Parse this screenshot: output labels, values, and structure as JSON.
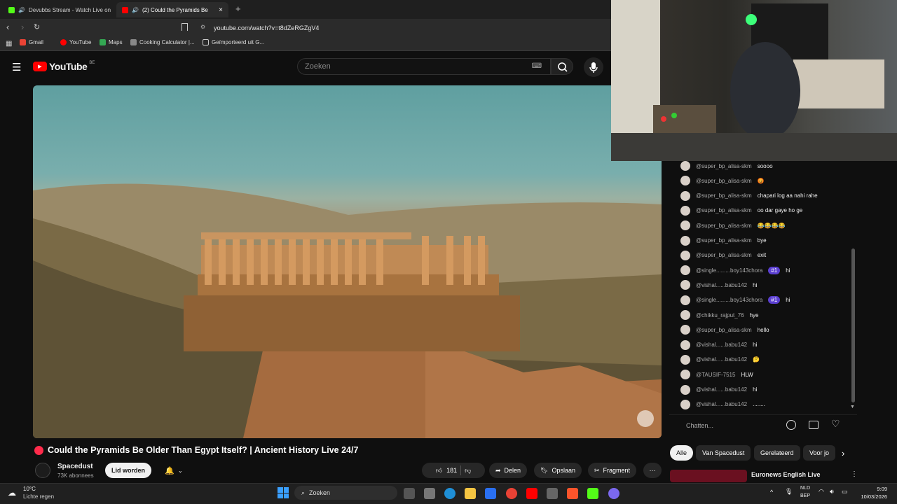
{
  "browser": {
    "tabs": [
      {
        "label": "Devubbs Stream - Watch Live on",
        "active": false
      },
      {
        "label": "(2)  Could the Pyramids Be",
        "active": true
      }
    ],
    "new_tab": "+",
    "url": "youtube.com/watch?v=t8dZeRGZgV4",
    "bookmarks": [
      "Gmail",
      "YouTube",
      "Maps",
      "Cooking Calculator |...",
      "Geïmporteerd uit G..."
    ]
  },
  "youtube": {
    "logo_text": "YouTube",
    "region": "BE",
    "search_placeholder": "Zoeken"
  },
  "video": {
    "title": "Could the Pyramids Be Older Than Egypt Itself? | Ancient History Live 24/7",
    "channel": "Spacedust",
    "subscribers": "73K abonnees",
    "join_label": "Lid worden",
    "likes": "181",
    "share_label": "Delen",
    "save_label": "Opslaan",
    "clip_label": "Fragment"
  },
  "chat": {
    "messages": [
      {
        "author": "@super_bp_alisa-skm",
        "text": "soooo",
        "badge": ""
      },
      {
        "author": "@super_bp_alisa-skm",
        "text": "😡",
        "badge": ""
      },
      {
        "author": "@super_bp_alisa-skm",
        "text": "chapari log aa nahi rahe",
        "badge": ""
      },
      {
        "author": "@super_bp_alisa-skm",
        "text": "oo dar gaye ho ge",
        "badge": ""
      },
      {
        "author": "@super_bp_alisa-skm",
        "text": "😂😂😂😂",
        "badge": ""
      },
      {
        "author": "@super_bp_alisa-skm",
        "text": "bye",
        "badge": ""
      },
      {
        "author": "@super_bp_alisa-skm",
        "text": "exit",
        "badge": ""
      },
      {
        "author": "@single.........boy143chora",
        "text": "hi",
        "badge": "#1"
      },
      {
        "author": "@vishal......babu142",
        "text": "hi",
        "badge": ""
      },
      {
        "author": "@single.........boy143chora",
        "text": "hi",
        "badge": "#1"
      },
      {
        "author": "@chikku_rajput_76",
        "text": "hye",
        "badge": ""
      },
      {
        "author": "@super_bp_alisa-skm",
        "text": "hello",
        "badge": ""
      },
      {
        "author": "@vishal......babu142",
        "text": "hi",
        "badge": ""
      },
      {
        "author": "@vishal......babu142",
        "text": "🤔",
        "badge": ""
      },
      {
        "author": "@TAUSIF-7515",
        "text": "HLW",
        "badge": ""
      },
      {
        "author": "@vishal......babu142",
        "text": "hi",
        "badge": ""
      },
      {
        "author": "@vishal......babu142",
        "text": "........",
        "badge": ""
      }
    ],
    "input_placeholder": "Chatten..."
  },
  "recommend": {
    "chips": [
      "Alle",
      "Van Spacedust",
      "Gerelateerd",
      "Voor jo"
    ],
    "first_title": "Euronews English Live"
  },
  "taskbar": {
    "weather_temp": "10°C",
    "weather_desc": "Lichte regen",
    "search": "Zoeken",
    "lang": "NLD",
    "lang_sub": "BEP",
    "time": "9:09",
    "date": "10/03/2026"
  },
  "colors": {
    "accent_red": "#ff0000",
    "background": "#0f0f0f",
    "badge": "#5b3fd1"
  }
}
